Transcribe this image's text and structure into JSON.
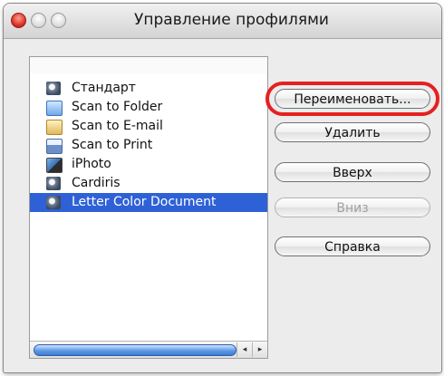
{
  "window": {
    "title": "Управление профилями"
  },
  "profiles": {
    "items": [
      {
        "label": "Стандарт",
        "icon": "cardiris-icon"
      },
      {
        "label": "Scan to Folder",
        "icon": "folder-icon"
      },
      {
        "label": "Scan to E-mail",
        "icon": "email-icon"
      },
      {
        "label": "Scan to Print",
        "icon": "printer-icon"
      },
      {
        "label": "iPhoto",
        "icon": "iphoto-icon"
      },
      {
        "label": "Cardiris",
        "icon": "cardiris-icon"
      },
      {
        "label": "Letter Color Document",
        "icon": "cardiris-icon"
      }
    ],
    "selected": "Letter Color Document",
    "scroll_left": "◂",
    "scroll_right": "▸"
  },
  "buttons": {
    "rename": "Переименовать...",
    "delete": "Удалить",
    "up": "Вверх",
    "down": "Вниз",
    "help": "Справка"
  },
  "colors": {
    "selection": "#2f61d6",
    "highlight_ring": "#e52020"
  }
}
